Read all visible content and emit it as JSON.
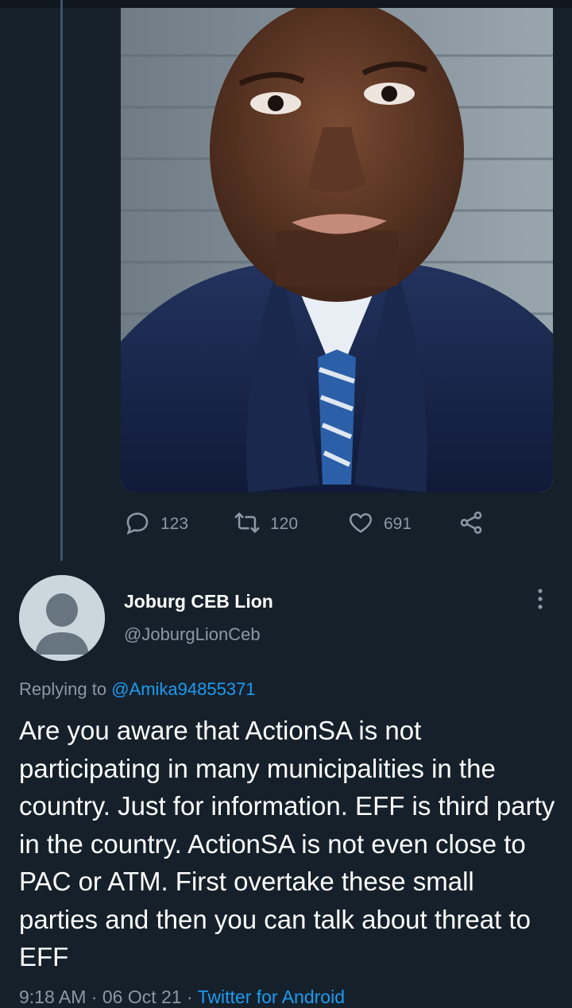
{
  "tweet": {
    "stats": {
      "replies": "123",
      "retweets": "120",
      "likes": "691"
    }
  },
  "reply": {
    "author_name": "Joburg CEB Lion",
    "author_handle": "@JoburgLionCeb",
    "replying_prefix": "Replying to",
    "replying_to": "@Amika94855371",
    "text": "Are you aware that ActionSA is not participating in many municipalities in the country. Just for information. EFF is third party in the country. ActionSA is not even close to PAC or ATM. First overtake these small parties and then you can talk about threat to EFF",
    "time": "9:18 AM",
    "date": "06 Oct 21",
    "separator": "·",
    "source": "Twitter for Android"
  },
  "icons": {
    "reply": "reply-icon",
    "retweet": "retweet-icon",
    "like": "heart-icon",
    "share": "share-icon",
    "more": "more-vertical-icon"
  },
  "colors": {
    "background": "#15202b",
    "secondary_text": "#8b98a5",
    "link": "#1d9bf0"
  }
}
